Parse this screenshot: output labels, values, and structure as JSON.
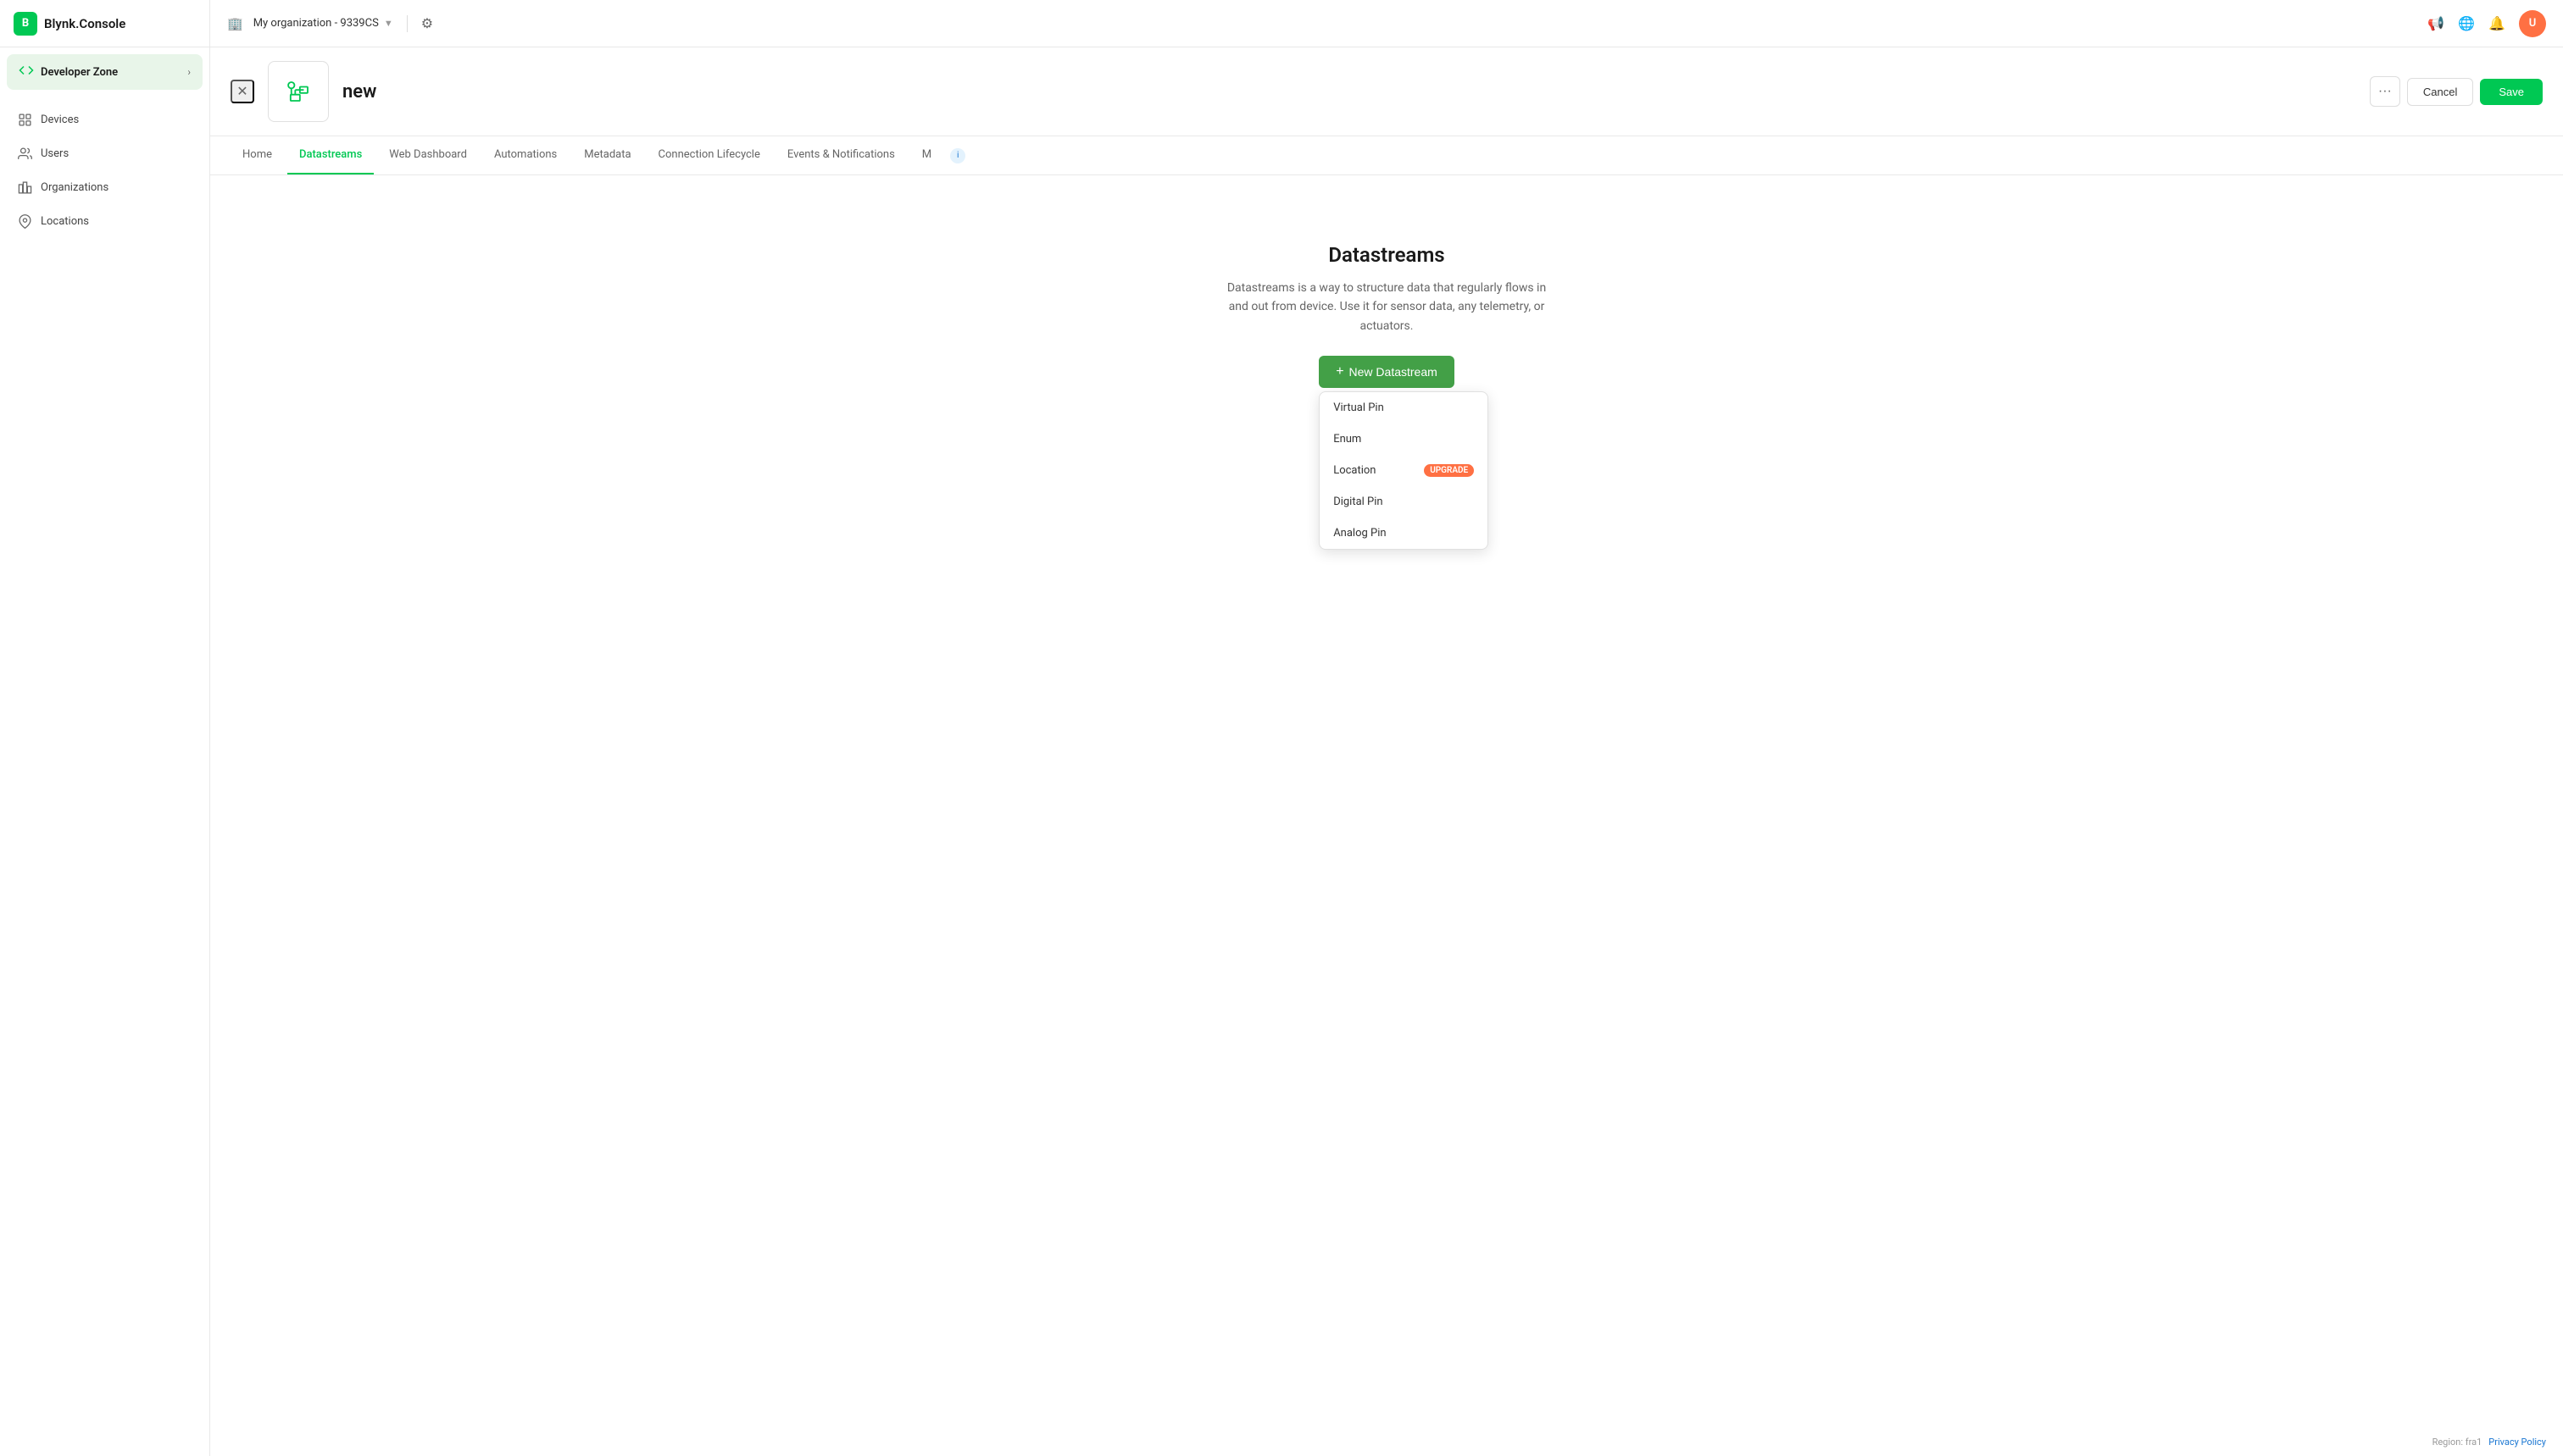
{
  "app": {
    "name": "Blynk.Console",
    "logo_letter": "B"
  },
  "sidebar": {
    "developer_zone": {
      "label": "Developer Zone"
    },
    "nav_items": [
      {
        "id": "devices",
        "label": "Devices",
        "icon": "device-icon"
      },
      {
        "id": "users",
        "label": "Users",
        "icon": "users-icon"
      },
      {
        "id": "organizations",
        "label": "Organizations",
        "icon": "org-icon"
      },
      {
        "id": "locations",
        "label": "Locations",
        "icon": "location-icon"
      }
    ]
  },
  "topbar": {
    "org_name": "My organization - 9339CS",
    "settings_icon": "settings-icon",
    "megaphone_icon": "megaphone-icon",
    "globe_icon": "globe-icon",
    "bell_icon": "bell-icon",
    "avatar_initials": "U"
  },
  "template": {
    "close_icon": "close-icon",
    "name": "new",
    "dots_label": "···",
    "cancel_label": "Cancel",
    "save_label": "Save"
  },
  "tabs": [
    {
      "id": "home",
      "label": "Home",
      "active": false
    },
    {
      "id": "datastreams",
      "label": "Datastreams",
      "active": true
    },
    {
      "id": "web-dashboard",
      "label": "Web Dashboard",
      "active": false
    },
    {
      "id": "automations",
      "label": "Automations",
      "active": false
    },
    {
      "id": "metadata",
      "label": "Metadata",
      "active": false
    },
    {
      "id": "connection-lifecycle",
      "label": "Connection Lifecycle",
      "active": false
    },
    {
      "id": "events-notifications",
      "label": "Events & Notifications",
      "active": false
    },
    {
      "id": "more",
      "label": "M",
      "active": false
    }
  ],
  "datastreams": {
    "title": "Datastreams",
    "description": "Datastreams is a way to structure data that regularly flows in and out from device. Use it for sensor data, any telemetry, or actuators.",
    "new_button_label": "New Datastream",
    "dropdown_items": [
      {
        "id": "virtual-pin",
        "label": "Virtual Pin",
        "badge": null
      },
      {
        "id": "enum",
        "label": "Enum",
        "badge": null
      },
      {
        "id": "location",
        "label": "Location",
        "badge": "UPGRADE"
      },
      {
        "id": "digital-pin",
        "label": "Digital Pin",
        "badge": null
      },
      {
        "id": "analog-pin",
        "label": "Analog Pin",
        "badge": null
      }
    ]
  },
  "footer": {
    "region_label": "Region: fra1",
    "privacy_label": "Privacy Policy"
  }
}
